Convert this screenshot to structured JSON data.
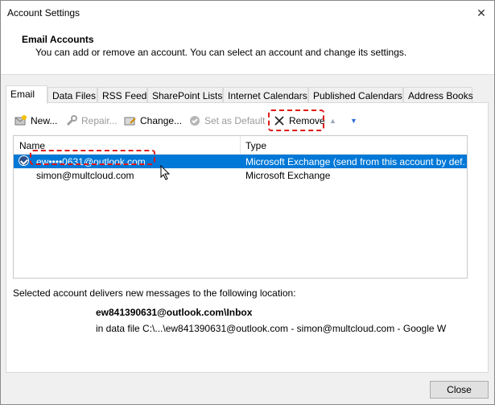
{
  "window": {
    "title": "Account Settings",
    "close_glyph": "✕"
  },
  "header": {
    "title": "Email Accounts",
    "description": "You can add or remove an account. You can select an account and change its settings."
  },
  "tabs": [
    {
      "label": "Email",
      "active": true
    },
    {
      "label": "Data Files"
    },
    {
      "label": "RSS Feeds"
    },
    {
      "label": "SharePoint Lists"
    },
    {
      "label": "Internet Calendars"
    },
    {
      "label": "Published Calendars"
    },
    {
      "label": "Address Books"
    }
  ],
  "toolbar": {
    "new_label": "New...",
    "repair_label": "Repair...",
    "change_label": "Change...",
    "default_label": "Set as Default",
    "remove_label": "Remove",
    "up_arrow": "▲",
    "down_arrow": "▼"
  },
  "list": {
    "columns": {
      "name": "Name",
      "type": "Type"
    },
    "rows": [
      {
        "name": "ew••••0631@outlook.com",
        "type": "Microsoft Exchange (send from this account by def...",
        "selected": true
      },
      {
        "name": "simon@multcloud.com",
        "type": "Microsoft Exchange",
        "selected": false
      }
    ]
  },
  "delivery": {
    "label": "Selected account delivers new messages to the following location:",
    "location": "ew841390631@outlook.com\\Inbox",
    "data_file": "in data file C:\\...\\ew841390631@outlook.com - simon@multcloud.com - Google W"
  },
  "footer": {
    "close_label": "Close"
  },
  "colors": {
    "selection": "#0078d7",
    "highlight_dashes": "#e01818"
  }
}
